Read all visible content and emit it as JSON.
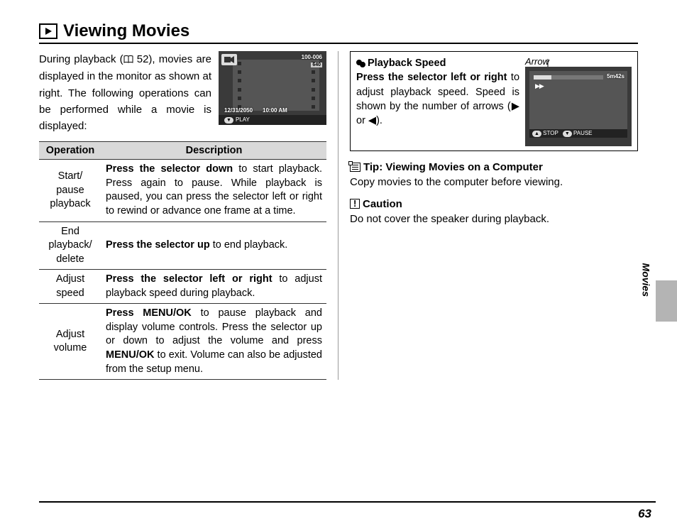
{
  "title": "Viewing Movies",
  "intro_pre": "During playback (",
  "intro_ref": "52",
  "intro_post": "), movies are displayed in the monitor as shown at right. The following operations can be performed while a movie is displayed:",
  "lcd1": {
    "file_no": "100-006",
    "res": "640",
    "date": "12/31/2050",
    "time": "10:00 AM",
    "play": "PLAY"
  },
  "table": {
    "h1": "Operation",
    "h2": "Description",
    "rows": [
      {
        "op": "Start/\npause\nplayback",
        "desc_b": "Press the selector down",
        "desc": " to start playback. Press again to pause. While playback is paused, you can press the selector left or right to rewind or advance one frame at a time."
      },
      {
        "op": "End\nplayback/\ndelete",
        "desc_b": "Press the selector up",
        "desc": " to end playback."
      },
      {
        "op": "Adjust\nspeed",
        "desc_b": "Press the selector left or right",
        "desc": " to adjust playback speed during playback."
      },
      {
        "op": "Adjust\nvolume",
        "desc_b": "Press MENU/OK",
        "desc_mid": " to pause playback and display volume controls. Press the selector up or down to adjust the volume and press ",
        "desc_b2": "MENU/OK",
        "desc_end": " to exit. Volume can also be adjusted from the setup menu."
      }
    ]
  },
  "notebox": {
    "title": "Playback Speed",
    "line1_b": "Press the selector left or right",
    "line1": " to adjust playback speed. Speed is shown by the number of arrows (▶ or ◀)."
  },
  "arrow_label": "Arrow",
  "lcd2": {
    "duration": "5m42s",
    "stop": "STOP",
    "pause": "PAUSE"
  },
  "tip_title": "Tip: Viewing Movies on a Computer",
  "tip_body": "Copy movies to the computer before viewing.",
  "caution_title": "Caution",
  "caution_body": "Do not cover the speaker during playback.",
  "side_label": "Movies",
  "page_number": "63"
}
